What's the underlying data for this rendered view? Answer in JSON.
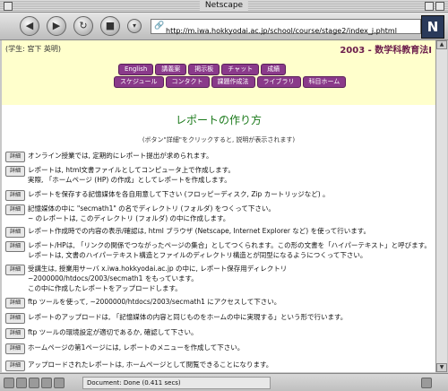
{
  "window": {
    "title": "Netscape"
  },
  "toolbar": {
    "back_glyph": "◀",
    "forward_glyph": "▶",
    "reload_glyph": "↻",
    "stop_glyph": "■",
    "url": "http://m.iwa.hokkyodai.ac.jp/school/course/stage2/index_j.phtml",
    "logo_text": "N"
  },
  "header": {
    "student": "(学生: 宮下 英明)",
    "year_title": "2003 - 数学科教育法I",
    "menu_row1": [
      "English",
      "講義案",
      "掲示板",
      "チャット",
      "成績"
    ],
    "menu_row2": [
      "スケジュール",
      "コンタクト",
      "課題作成法",
      "ライブラリ",
      "科目ホーム"
    ]
  },
  "page": {
    "title": "レポートの作り方",
    "hint": "(ボタン\"詳細\"をクリックすると, 説明が表示されます)",
    "detail_label": "詳細"
  },
  "items": [
    {
      "lines": [
        "オンライン授業では, 定期的にレポート提出が求められます。"
      ]
    },
    {
      "lines": [
        "レポートは, html文書ファイルとしてコンピュータ上で作成します。",
        "実際, 「ホームページ (HP) の作成」としてレポートを作成します。"
      ]
    },
    {
      "lines": [
        "レポートを保存する記憶媒体を各自用意して下さい (フロッピーディスク, Zip カートリッジなど) 。"
      ]
    },
    {
      "lines": [
        "記憶媒体の中に \"secmath1\" の名でディレクトリ (フォルダ) をつくって下さい。",
        "~ のレポートは, このディレクトリ (フォルダ) の中に作成します。"
      ]
    },
    {
      "lines": [
        "レポート作成時での内容の表示/確認は, html ブラウザ (Netscape, Internet Explorer など) を使って行います。"
      ]
    },
    {
      "lines": [
        "レポート/HPは, 「リンクの関係でつながったページの集合」としてつくられます。この形の文書を「ハイパーテキスト」と呼びます。",
        "レポートは, 文書のハイパーテキスト構造とファイルのディレクトリ構造とが同型になるようにつくって下さい。"
      ]
    },
    {
      "lines": [
        "受講生は, 授業用サーバ x.iwa.hokkyodai.ac.jp の中に, レポート保存用ディレクトリ",
        "~2000000/htdocs/2003/secmath1 をもっています。",
        "この中に作成したレポートをアップロードします。"
      ]
    },
    {
      "lines": [
        "ftp ツールを使って, ~2000000/htdocs/2003/secmath1 にアクセスして下さい。"
      ]
    },
    {
      "lines": [
        "レポートのアップロードは, 「記憶媒体の内容と同じものをホームの中に実現する」という形で行います。"
      ]
    },
    {
      "lines": [
        "ftp ツールの環境設定が適切であるか, 確認して下さい。"
      ]
    },
    {
      "lines": [
        "ホームページの第1ページには, レポートのメニューを作成して下さい。"
      ]
    },
    {
      "lines": [
        "アップロードされたレポートは, ホームページとして閲覧できることになります。"
      ]
    }
  ],
  "status": {
    "text": "Document: Done (0.411 secs)"
  }
}
